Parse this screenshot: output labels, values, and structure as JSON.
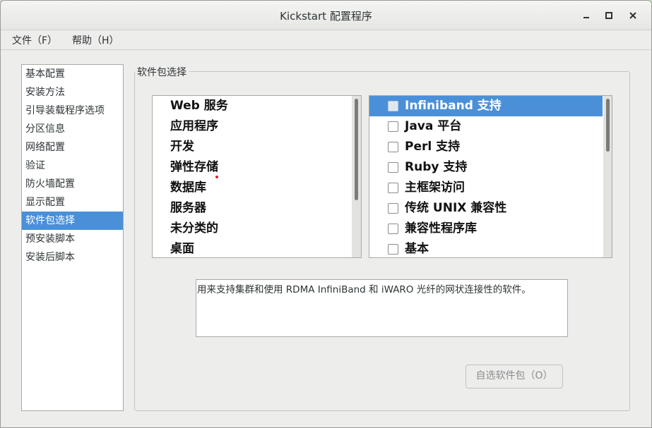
{
  "window": {
    "title": "Kickstart 配置程序",
    "controls": {
      "minimize": "×",
      "maximize": "□",
      "close": "✕"
    }
  },
  "menubar": {
    "file": "文件（F）",
    "help": "帮助（H）"
  },
  "sidebar": {
    "items": [
      {
        "label": "基本配置"
      },
      {
        "label": "安装方法"
      },
      {
        "label": "引导装载程序选项"
      },
      {
        "label": "分区信息"
      },
      {
        "label": "网络配置"
      },
      {
        "label": "验证"
      },
      {
        "label": "防火墙配置"
      },
      {
        "label": "显示配置"
      },
      {
        "label": "软件包选择",
        "selected": true
      },
      {
        "label": "预安装脚本"
      },
      {
        "label": "安装后脚本"
      }
    ]
  },
  "main": {
    "section_title": "软件包选择",
    "groups": [
      "Web 服务",
      "应用程序",
      "开发",
      "弹性存储",
      "数据库",
      "服务器",
      "未分类的",
      "桌面"
    ],
    "packages": [
      {
        "label": "Infiniband 支持",
        "checked": false,
        "selected": true
      },
      {
        "label": "Java 平台",
        "checked": false
      },
      {
        "label": "Perl 支持",
        "checked": false
      },
      {
        "label": "Ruby 支持",
        "checked": false
      },
      {
        "label": "主框架访问",
        "checked": false
      },
      {
        "label": "传统 UNIX 兼容性",
        "checked": false
      },
      {
        "label": "兼容性程序库",
        "checked": false
      },
      {
        "label": "基本",
        "checked": false
      }
    ],
    "description": "用来支持集群和使用 RDMA InfiniBand 和 iWARO 光纤的网状连接性的软件。",
    "optional_button": "自选软件包（O）"
  },
  "colors": {
    "selection": "#4a90d9",
    "window_bg": "#ededeb"
  }
}
